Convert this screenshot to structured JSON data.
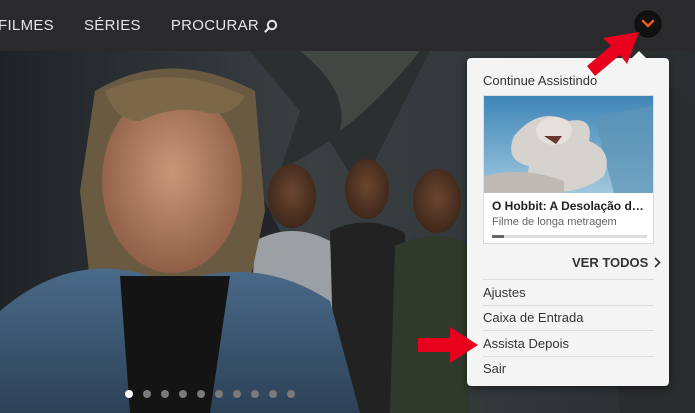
{
  "nav": {
    "items": [
      "FILMES",
      "SÉRIES",
      "PROCURAR"
    ],
    "search_icon": "search-icon",
    "menu_icon": "chevron-down-icon",
    "accent": "#e85d1a"
  },
  "dropdown": {
    "heading": "Continue Assistindo",
    "card": {
      "title": "O Hobbit: A Desolação de Smaug",
      "subtitle": "Filme de longa metragem",
      "progress": 0.08
    },
    "see_all": "VER TODOS",
    "items": [
      "Ajustes",
      "Caixa de Entrada",
      "Assista Depois",
      "Sair"
    ]
  },
  "carousel": {
    "count": 10,
    "active": 0
  },
  "annotations": {
    "arrow_color": "#e8001c"
  }
}
